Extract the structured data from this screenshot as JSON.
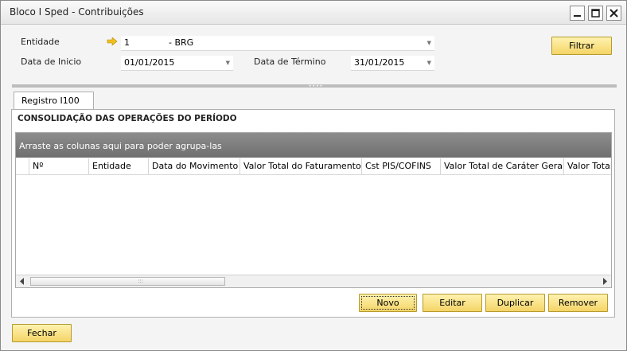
{
  "window": {
    "title": "Bloco I Sped - Contribuições"
  },
  "form": {
    "entidade_label": "Entidade",
    "entidade_code": "1",
    "entidade_name": "- BRG",
    "data_inicio_label": "Data de Inicio",
    "data_inicio_value": "01/01/2015",
    "data_termino_label": "Data de Término",
    "data_termino_value": "31/01/2015",
    "filtrar_label": "Filtrar"
  },
  "tab": {
    "label": "Registro I100"
  },
  "section": {
    "title": "CONSOLIDAÇÃO DAS OPERAÇÕES DO PERÍODO"
  },
  "grid": {
    "group_hint": "Arraste as colunas aqui para poder agrupa-las",
    "columns": [
      "Nº",
      "Entidade",
      "Data do Movimento",
      "Valor Total do Faturamento",
      "Cst PIS/COFINS",
      "Valor Total de Caráter Geral",
      "Valor Total d"
    ]
  },
  "actions": {
    "novo": "Novo",
    "editar": "Editar",
    "duplicar": "Duplicar",
    "remover": "Remover",
    "fechar": "Fechar"
  },
  "colors": {
    "button_fill": "#f4d466",
    "button_border": "#b59a2e",
    "group_bar": "#7a7a7a"
  }
}
